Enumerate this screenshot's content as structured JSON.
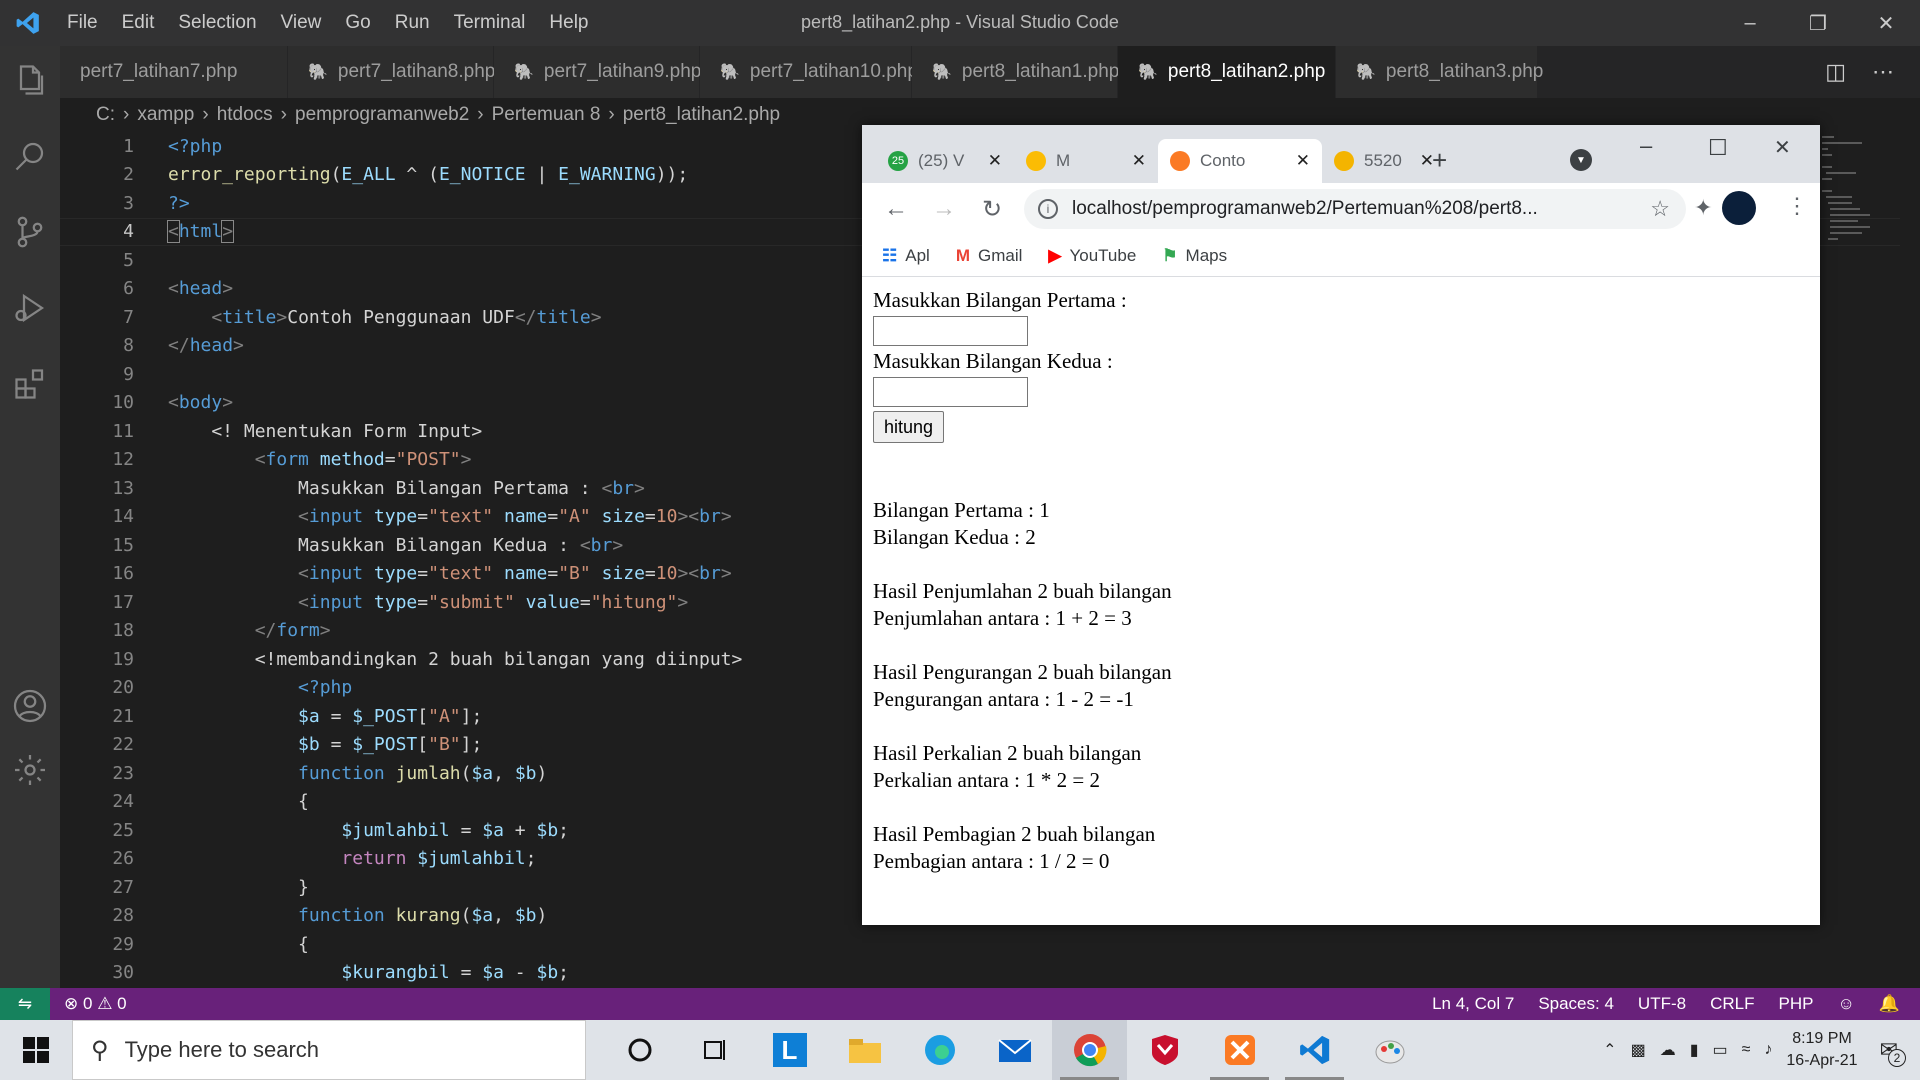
{
  "titlebar": {
    "menu": [
      "File",
      "Edit",
      "Selection",
      "View",
      "Go",
      "Run",
      "Terminal",
      "Help"
    ],
    "title": "pert8_latihan2.php - Visual Studio Code"
  },
  "tabs": [
    {
      "label": "pert7_latihan7.php",
      "active": false
    },
    {
      "label": "pert7_latihan8.php",
      "active": false
    },
    {
      "label": "pert7_latihan9.php",
      "active": false
    },
    {
      "label": "pert7_latihan10.php",
      "active": false
    },
    {
      "label": "pert8_latihan1.php",
      "active": false
    },
    {
      "label": "pert8_latihan2.php",
      "active": true
    },
    {
      "label": "pert8_latihan3.php",
      "active": false
    }
  ],
  "breadcrumb": [
    "C:",
    "xampp",
    "htdocs",
    "pemprogramanweb2",
    "Pertemuan 8",
    "pert8_latihan2.php"
  ],
  "code_lines": [
    {
      "n": "1",
      "html": "<span style='color:#569cd6'>&lt;?php</span>"
    },
    {
      "n": "2",
      "html": "<span style='color:#dcdcaa'>error_reporting</span>(<span style='color:#9cdcfe'>E_ALL</span> ^ (<span style='color:#9cdcfe'>E_NOTICE</span> | <span style='color:#9cdcfe'>E_WARNING</span>));"
    },
    {
      "n": "3",
      "html": "<span style='color:#569cd6'>?&gt;</span>"
    },
    {
      "n": "4",
      "html": "<span style='color:#808080;outline:1px solid #888'>&lt;</span><span style='color:#569cd6'>html</span><span style='color:#808080;outline:1px solid #888'>&gt;</span>"
    },
    {
      "n": "5",
      "html": ""
    },
    {
      "n": "6",
      "html": "<span style='color:#808080'>&lt;</span><span style='color:#569cd6'>head</span><span style='color:#808080'>&gt;</span>"
    },
    {
      "n": "7",
      "html": "    <span style='color:#808080'>&lt;</span><span style='color:#569cd6'>title</span><span style='color:#808080'>&gt;</span>Contoh Penggunaan UDF<span style='color:#808080'>&lt;/</span><span style='color:#569cd6'>title</span><span style='color:#808080'>&gt;</span>"
    },
    {
      "n": "8",
      "html": "<span style='color:#808080'>&lt;/</span><span style='color:#569cd6'>head</span><span style='color:#808080'>&gt;</span>"
    },
    {
      "n": "9",
      "html": ""
    },
    {
      "n": "10",
      "html": "<span style='color:#808080'>&lt;</span><span style='color:#569cd6'>body</span><span style='color:#808080'>&gt;</span>"
    },
    {
      "n": "11",
      "html": "    &lt;! Menentukan Form Input&gt;"
    },
    {
      "n": "12",
      "html": "        <span style='color:#808080'>&lt;</span><span style='color:#569cd6'>form</span> <span style='color:#9cdcfe'>method</span>=<span style='color:#ce9178'>\"POST\"</span><span style='color:#808080'>&gt;</span>"
    },
    {
      "n": "13",
      "html": "            Masukkan Bilangan Pertama : <span style='color:#808080'>&lt;</span><span style='color:#569cd6'>br</span><span style='color:#808080'>&gt;</span>"
    },
    {
      "n": "14",
      "html": "            <span style='color:#808080'>&lt;</span><span style='color:#569cd6'>input</span> <span style='color:#9cdcfe'>type</span>=<span style='color:#ce9178'>\"text\"</span> <span style='color:#9cdcfe'>name</span>=<span style='color:#ce9178'>\"A\"</span> <span style='color:#9cdcfe'>size</span>=<span style='color:#ce9178'>10</span><span style='color:#808080'>&gt;&lt;</span><span style='color:#569cd6'>br</span><span style='color:#808080'>&gt;</span>"
    },
    {
      "n": "15",
      "html": "            Masukkan Bilangan Kedua : <span style='color:#808080'>&lt;</span><span style='color:#569cd6'>br</span><span style='color:#808080'>&gt;</span>"
    },
    {
      "n": "16",
      "html": "            <span style='color:#808080'>&lt;</span><span style='color:#569cd6'>input</span> <span style='color:#9cdcfe'>type</span>=<span style='color:#ce9178'>\"text\"</span> <span style='color:#9cdcfe'>name</span>=<span style='color:#ce9178'>\"B\"</span> <span style='color:#9cdcfe'>size</span>=<span style='color:#ce9178'>10</span><span style='color:#808080'>&gt;&lt;</span><span style='color:#569cd6'>br</span><span style='color:#808080'>&gt;</span>"
    },
    {
      "n": "17",
      "html": "            <span style='color:#808080'>&lt;</span><span style='color:#569cd6'>input</span> <span style='color:#9cdcfe'>type</span>=<span style='color:#ce9178'>\"submit\"</span> <span style='color:#9cdcfe'>value</span>=<span style='color:#ce9178'>\"hitung\"</span><span style='color:#808080'>&gt;</span>"
    },
    {
      "n": "18",
      "html": "        <span style='color:#808080'>&lt;/</span><span style='color:#569cd6'>form</span><span style='color:#808080'>&gt;</span>"
    },
    {
      "n": "19",
      "html": "        &lt;!membandingkan 2 buah bilangan yang diinput&gt;"
    },
    {
      "n": "20",
      "html": "            <span style='color:#569cd6'>&lt;?php</span>"
    },
    {
      "n": "21",
      "html": "            <span style='color:#9cdcfe'>$a</span> = <span style='color:#9cdcfe'>$_POST</span>[<span style='color:#ce9178'>\"A\"</span>];"
    },
    {
      "n": "22",
      "html": "            <span style='color:#9cdcfe'>$b</span> = <span style='color:#9cdcfe'>$_POST</span>[<span style='color:#ce9178'>\"B\"</span>];"
    },
    {
      "n": "23",
      "html": "            <span style='color:#569cd6'>function</span> <span style='color:#dcdcaa'>jumlah</span>(<span style='color:#9cdcfe'>$a</span>, <span style='color:#9cdcfe'>$b</span>)"
    },
    {
      "n": "24",
      "html": "            {"
    },
    {
      "n": "25",
      "html": "                <span style='color:#9cdcfe'>$jumlahbil</span> = <span style='color:#9cdcfe'>$a</span> + <span style='color:#9cdcfe'>$b</span>;"
    },
    {
      "n": "26",
      "html": "                <span style='color:#c586c0'>return</span> <span style='color:#9cdcfe'>$jumlahbil</span>;"
    },
    {
      "n": "27",
      "html": "            }"
    },
    {
      "n": "28",
      "html": "            <span style='color:#569cd6'>function</span> <span style='color:#dcdcaa'>kurang</span>(<span style='color:#9cdcfe'>$a</span>, <span style='color:#9cdcfe'>$b</span>)"
    },
    {
      "n": "29",
      "html": "            {"
    },
    {
      "n": "30",
      "html": "                <span style='color:#9cdcfe'>$kurangbil</span> = <span style='color:#9cdcfe'>$a</span> - <span style='color:#9cdcfe'>$b</span>;"
    }
  ],
  "status": {
    "errors": "0",
    "warnings": "0",
    "position": "Ln 4, Col 7",
    "spaces": "Spaces: 4",
    "encoding": "UTF-8",
    "eol": "CRLF",
    "language": "PHP"
  },
  "browser": {
    "tabs": [
      {
        "label": "(25) V",
        "fav_color": "#25a244",
        "fav_text": "25"
      },
      {
        "label": "M",
        "fav_color": "#fbbc04",
        "fav_text": ""
      },
      {
        "label": "Conto",
        "fav_color": "#fb7a24",
        "fav_text": ""
      },
      {
        "label": "5520",
        "fav_color": "#f4b400",
        "fav_text": ""
      }
    ],
    "url": "localhost/pemprogramanweb2/Pertemuan%208/pert8...",
    "bookmarks": [
      "Apl",
      "Gmail",
      "YouTube",
      "Maps"
    ],
    "page": {
      "label_a": "Masukkan Bilangan Pertama :",
      "label_b": "Masukkan Bilangan Kedua :",
      "submit": "hitung",
      "results": [
        "Bilangan Pertama : 1",
        "Bilangan Kedua : 2",
        "",
        "Hasil Penjumlahan 2 buah bilangan",
        "Penjumlahan antara : 1 + 2 = 3",
        "",
        "Hasil Pengurangan 2 buah bilangan",
        "Pengurangan antara : 1 - 2 = -1",
        "",
        "Hasil Perkalian 2 buah bilangan",
        "Perkalian antara : 1 * 2 = 2",
        "",
        "Hasil Pembagian 2 buah bilangan",
        "Pembagian antara : 1 / 2 = 0"
      ]
    }
  },
  "taskbar": {
    "search_placeholder": "Type here to search",
    "time": "8:19 PM",
    "date": "16-Apr-21",
    "notifications": "2"
  }
}
